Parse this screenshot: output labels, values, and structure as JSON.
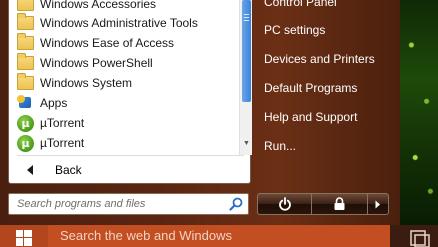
{
  "programs": {
    "items": [
      {
        "label": "Windows Accessories",
        "icon": "folder-icon"
      },
      {
        "label": "Windows Administrative Tools",
        "icon": "folder-icon"
      },
      {
        "label": "Windows Ease of Access",
        "icon": "folder-icon"
      },
      {
        "label": "Windows PowerShell",
        "icon": "folder-icon"
      },
      {
        "label": "Windows System",
        "icon": "folder-icon"
      },
      {
        "label": "Apps",
        "icon": "apps-icon"
      },
      {
        "label": "µTorrent",
        "icon": "utorrent-icon"
      },
      {
        "label": "µTorrent",
        "icon": "utorrent-icon"
      }
    ],
    "torrent_glyph": "µ",
    "back_label": "Back"
  },
  "search": {
    "placeholder": "Search programs and files"
  },
  "right_column": {
    "items": [
      {
        "label": "Control Panel"
      },
      {
        "label": "PC settings"
      },
      {
        "label": "Devices and Printers"
      },
      {
        "label": "Default Programs"
      },
      {
        "label": "Help and Support"
      },
      {
        "label": "Run..."
      }
    ]
  },
  "power": {
    "icons": [
      "power-icon",
      "lock-icon",
      "arrow-right-icon"
    ]
  },
  "taskbar": {
    "search_placeholder": "Search the web and Windows"
  },
  "colors": {
    "menu_bg": "#5a2612",
    "taskbar_search": "#c34e22",
    "start_button": "#b2461f",
    "scroll_thumb": "#3c82d8"
  }
}
